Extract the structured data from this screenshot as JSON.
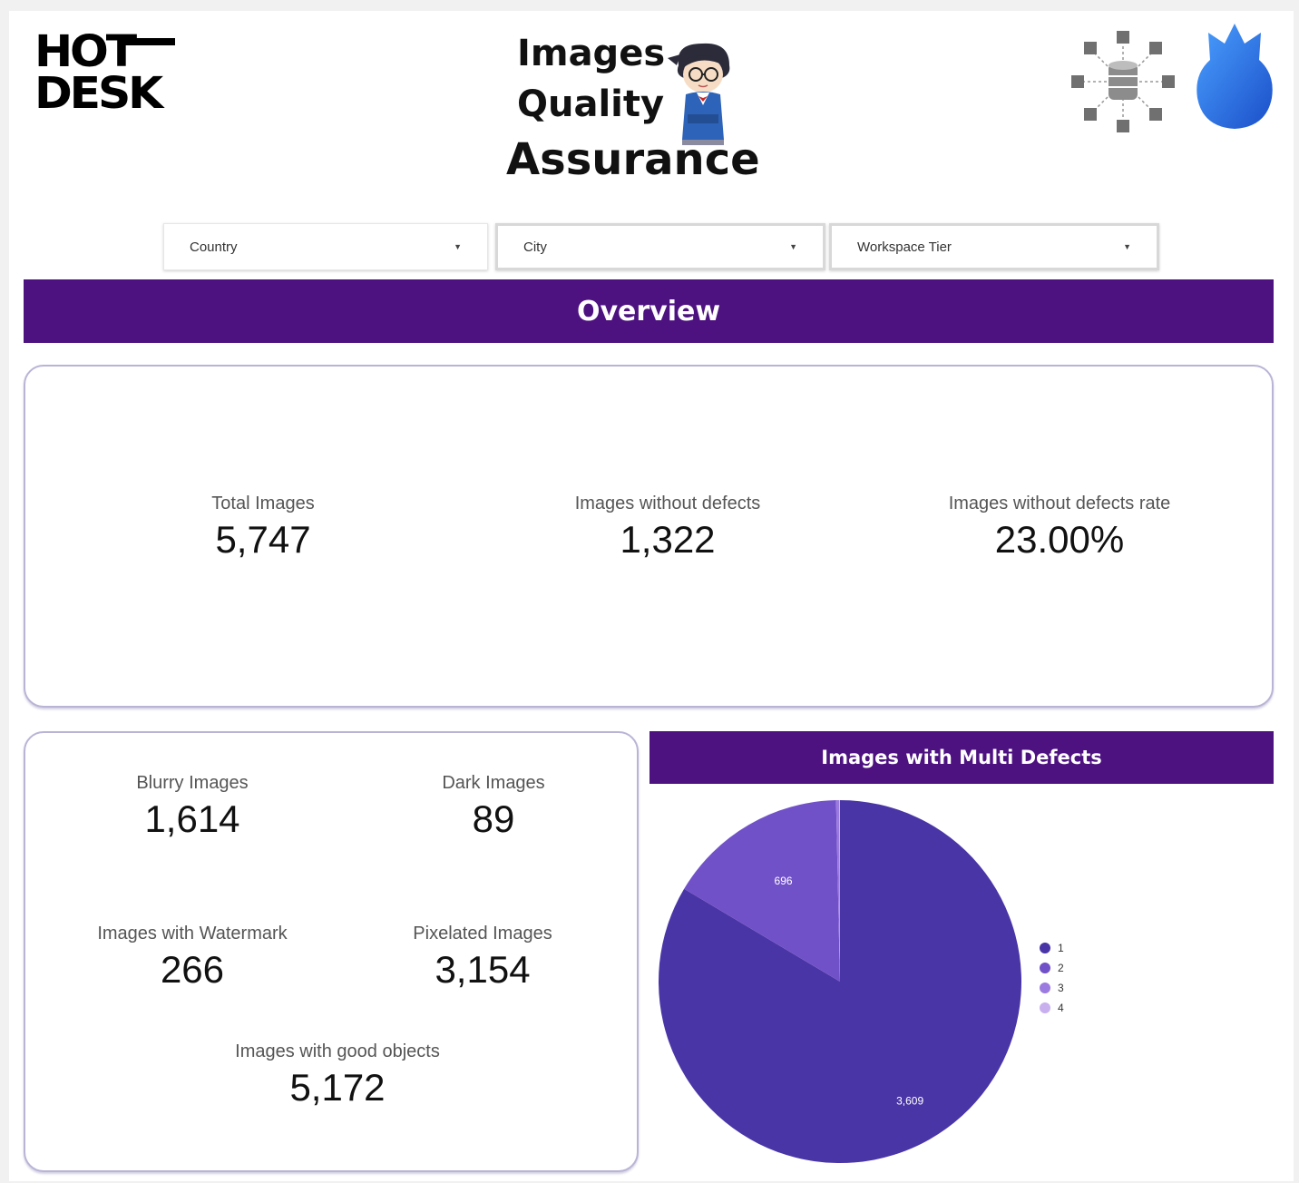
{
  "header": {
    "logo_line1": "HOT",
    "logo_line2": "DESK",
    "title_line1": "Images",
    "title_line2": "Quality",
    "title_line3": "Assurance"
  },
  "filters": [
    {
      "label": "Country"
    },
    {
      "label": "City"
    },
    {
      "label": "Workspace Tier"
    }
  ],
  "overview": {
    "title": "Overview",
    "kpis": [
      {
        "label": "Total Images",
        "value": "5,747"
      },
      {
        "label": "Images without defects",
        "value": "1,322"
      },
      {
        "label": "Images without defects rate",
        "value": "23.00%"
      }
    ]
  },
  "defects": {
    "kpis": [
      {
        "label": "Blurry Images",
        "value": "1,614"
      },
      {
        "label": "Dark Images",
        "value": "89"
      },
      {
        "label": "Images with Watermark",
        "value": "266"
      },
      {
        "label": "Pixelated Images",
        "value": "3,154"
      },
      {
        "label": "Images with good objects",
        "value": "5,172"
      }
    ]
  },
  "colors": {
    "brand_purple": "#4d1280",
    "series": [
      "#4a35a6",
      "#7151c8",
      "#9c7be0",
      "#c8b0ef"
    ]
  },
  "chart_data": {
    "type": "pie",
    "title": "Images with Multi Defects",
    "categories": [
      "1",
      "2",
      "3",
      "4"
    ],
    "values": [
      3609,
      696,
      12,
      3
    ],
    "data_labels": [
      "3,609",
      "696",
      "",
      ""
    ],
    "legend": "right"
  }
}
